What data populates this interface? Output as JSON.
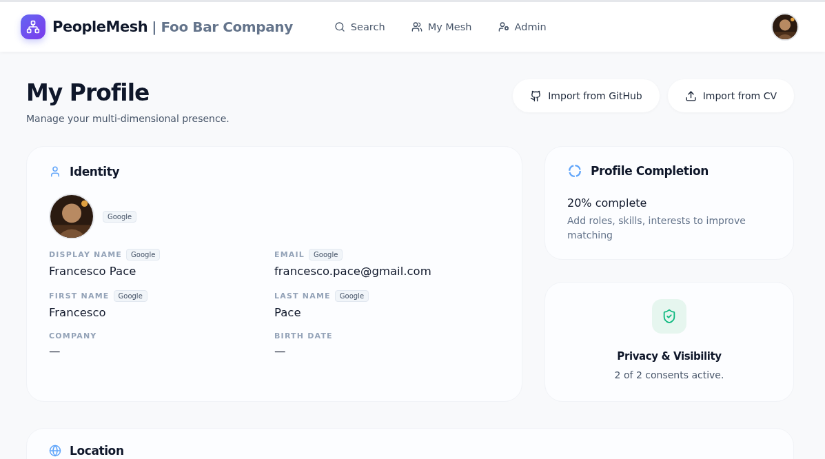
{
  "header": {
    "brand": "PeopleMesh",
    "company": "| Foo Bar Company",
    "nav": [
      {
        "label": "Search"
      },
      {
        "label": "My Mesh"
      },
      {
        "label": "Admin"
      }
    ]
  },
  "page": {
    "title": "My Profile",
    "subtitle": "Manage your multi-dimensional presence.",
    "actions": [
      {
        "label": "Import from GitHub"
      },
      {
        "label": "Import from CV"
      }
    ]
  },
  "identity": {
    "title": "Identity",
    "avatar_source": "Google",
    "fields": [
      {
        "label": "DISPLAY NAME",
        "source": "Google",
        "value": "Francesco Pace"
      },
      {
        "label": "EMAIL",
        "source": "Google",
        "value": "francesco.pace@gmail.com"
      },
      {
        "label": "FIRST NAME",
        "source": "Google",
        "value": "Francesco"
      },
      {
        "label": "LAST NAME",
        "source": "Google",
        "value": "Pace"
      },
      {
        "label": "COMPANY",
        "value": "—"
      },
      {
        "label": "BIRTH DATE",
        "value": "—"
      }
    ]
  },
  "completion": {
    "title": "Profile Completion",
    "status": "20% complete",
    "hint": "Add roles, skills, interests to improve matching"
  },
  "privacy": {
    "title": "Privacy & Visibility",
    "status": "2 of 2 consents active."
  },
  "location": {
    "title": "Location"
  }
}
